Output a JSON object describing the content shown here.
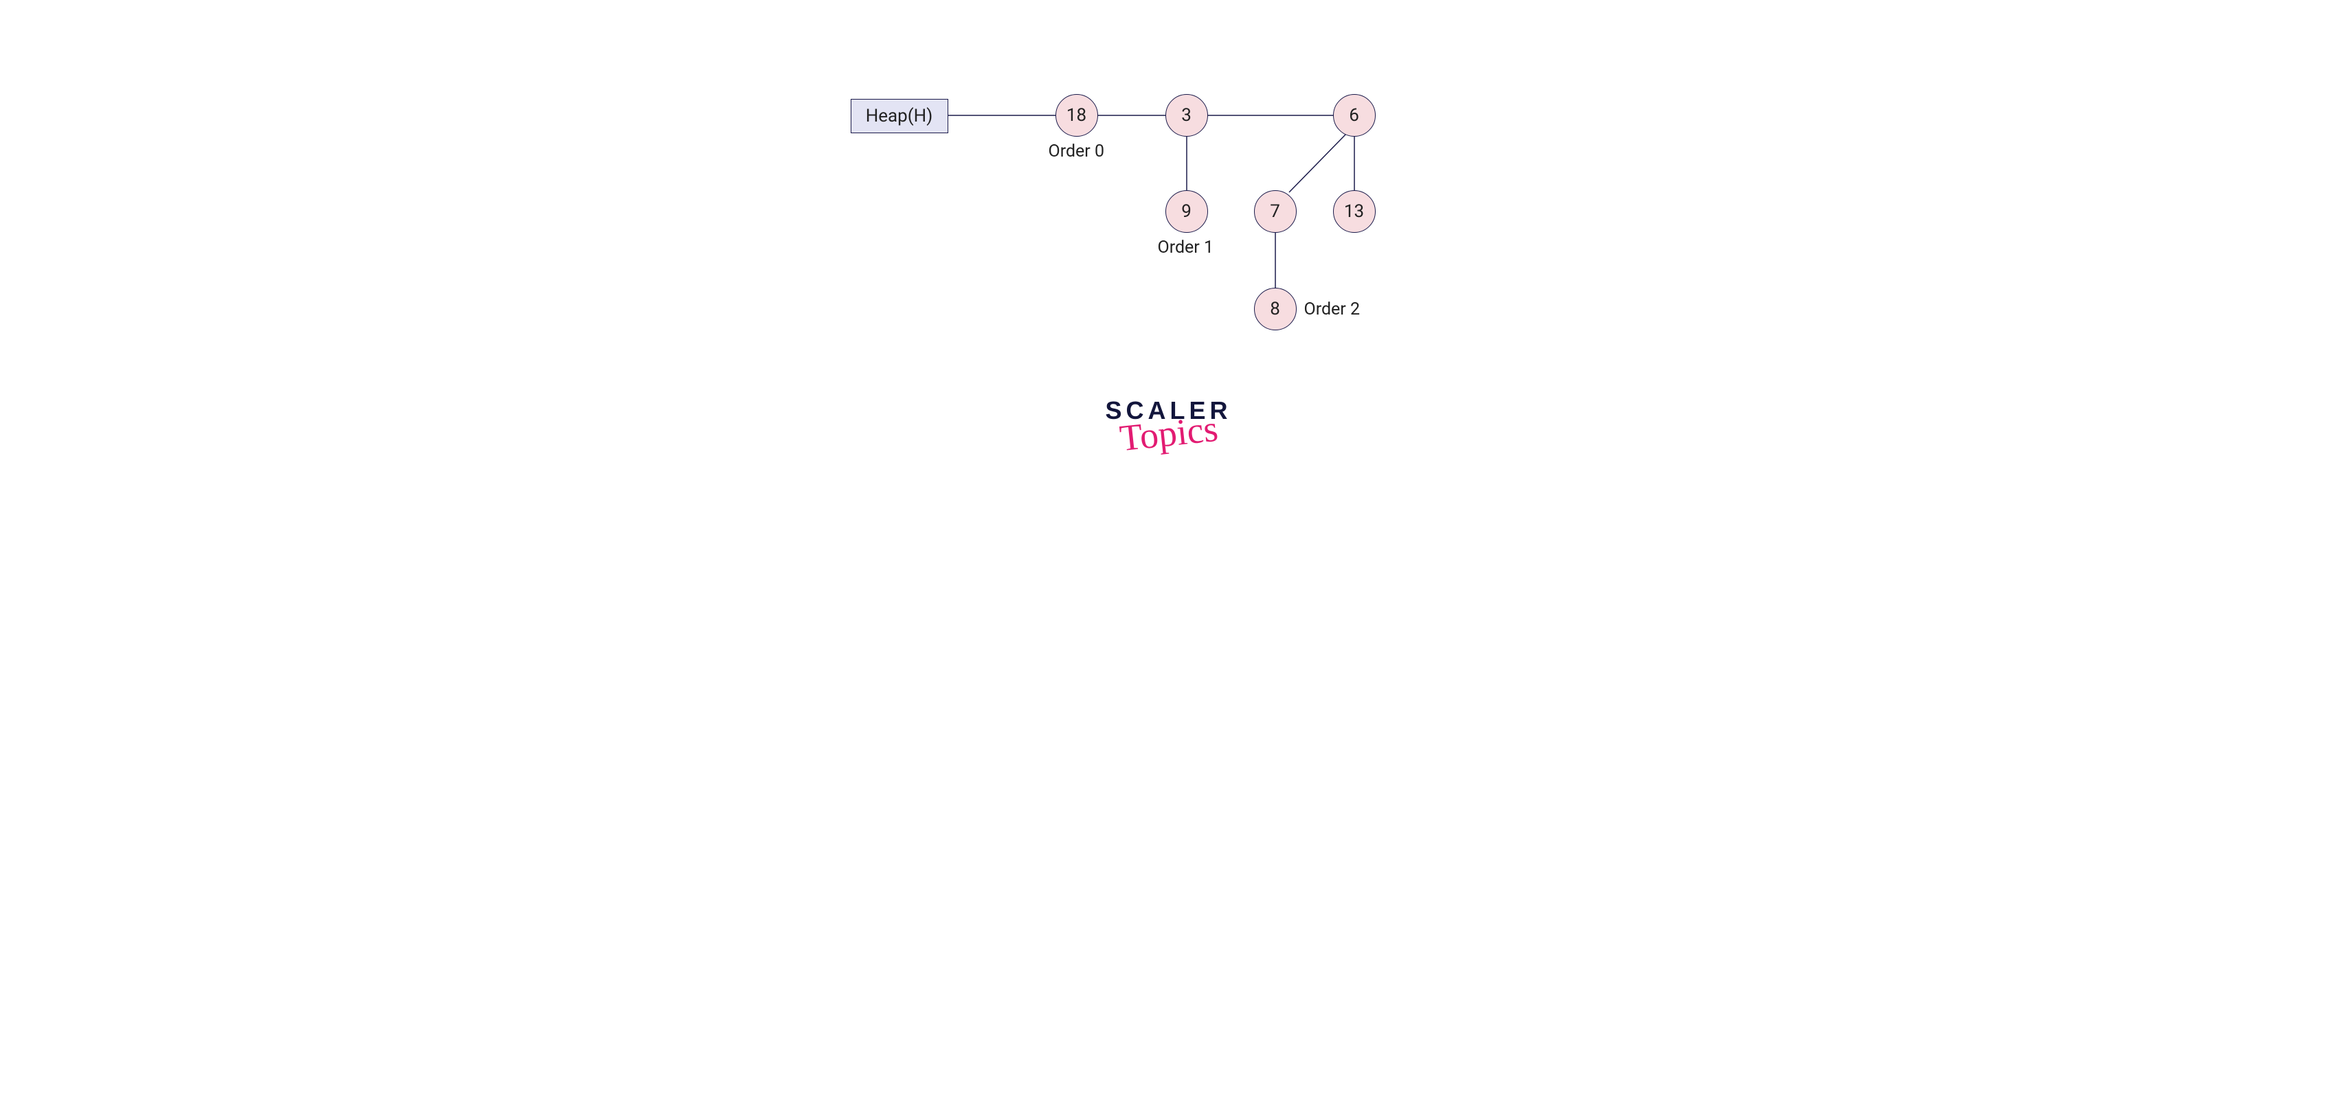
{
  "diagram": {
    "heap_label": "Heap(H)",
    "nodes": {
      "n18": "18",
      "n3": "3",
      "n6": "6",
      "n9": "9",
      "n7": "7",
      "n13": "13",
      "n8": "8"
    },
    "labels": {
      "order0": "Order 0",
      "order1": "Order 1",
      "order2": "Order 2"
    }
  },
  "brand": {
    "line1": "SCALER",
    "line2": "Topics"
  },
  "chart_data": {
    "type": "tree",
    "structure": "binomial-heap",
    "root_label": "Heap(H)",
    "trees": [
      {
        "order": 0,
        "root": 18,
        "children": []
      },
      {
        "order": 1,
        "root": 3,
        "children": [
          {
            "value": 9,
            "children": []
          }
        ]
      },
      {
        "order": 2,
        "root": 6,
        "children": [
          {
            "value": 7,
            "children": [
              {
                "value": 8,
                "children": []
              }
            ]
          },
          {
            "value": 13,
            "children": []
          }
        ]
      }
    ]
  }
}
